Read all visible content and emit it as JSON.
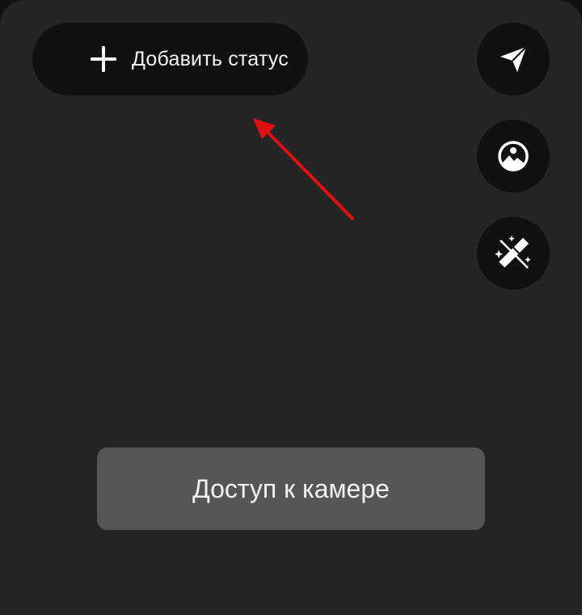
{
  "status_bar": {
    "add_status_label": "Добавить статус",
    "add_icon": "plus-icon"
  },
  "side_actions": [
    {
      "name": "send",
      "icon": "send-icon"
    },
    {
      "name": "gallery",
      "icon": "image-icon"
    },
    {
      "name": "effects",
      "icon": "magic-wand-icon"
    }
  ],
  "camera_access": {
    "label": "Доступ к камере"
  },
  "colors": {
    "panel_bg": "#252525",
    "button_bg": "#111111",
    "camera_button_bg": "#565656",
    "text": "#f2f2f2",
    "annotation_arrow": "#e01010"
  }
}
